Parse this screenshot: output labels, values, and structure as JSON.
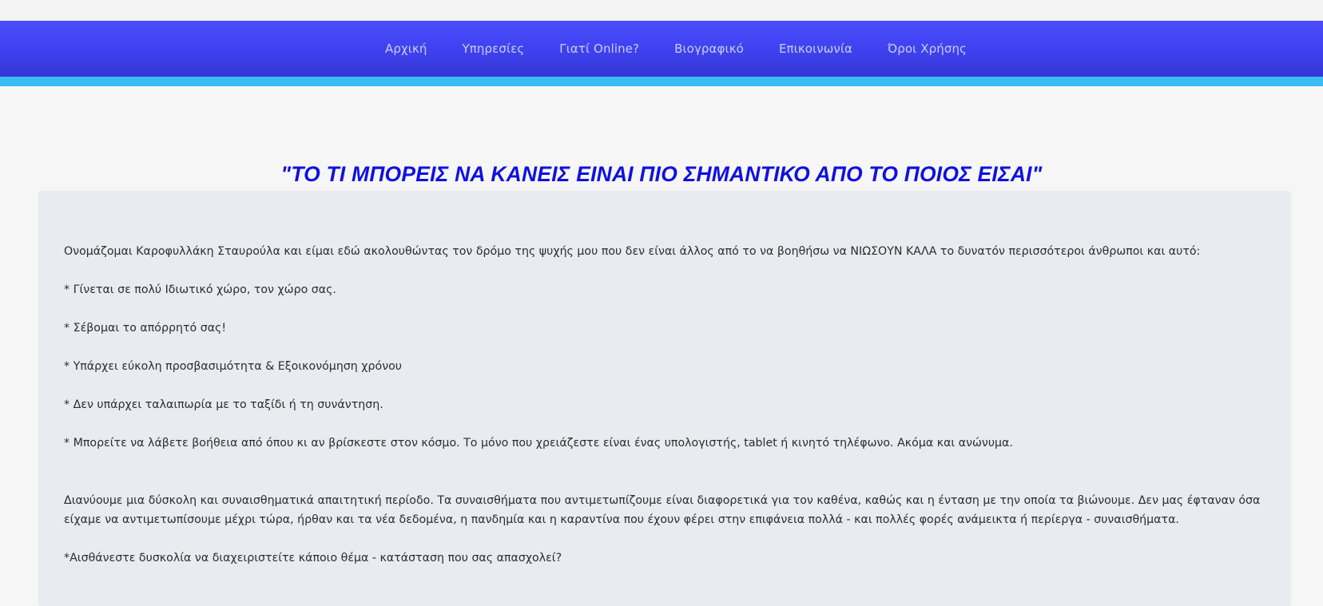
{
  "nav": {
    "items": [
      {
        "label": "Αρχική"
      },
      {
        "label": "Υπηρεσίες"
      },
      {
        "label": "Γιατί Online?"
      },
      {
        "label": "Βιογραφικό"
      },
      {
        "label": "Επικοινωνία"
      },
      {
        "label": "Όροι Χρήσης"
      }
    ]
  },
  "colors": {
    "nav_bg": "#4143f0",
    "nav_accent": "#3bbcf6",
    "headline": "#1010e0",
    "content_bg": "#e8ebef"
  },
  "main": {
    "headline": "\"ΤΟ ΤΙ ΜΠΟΡΕΙΣ ΝΑ ΚΑΝΕΙΣ ΕΙΝΑΙ ΠΙΟ ΣΗΜΑΝΤΙΚΟ ΑΠΟ ΤΟ ΠΟΙΟΣ ΕΙΣΑΙ\"",
    "intro": "Ονομάζομαι Καροφυλλάκη Σταυρούλα και είμαι εδώ ακολουθώντας τον δρόμο της ψυχής μου που δεν είναι άλλος από το να βοηθήσω να ΝΙΩΣΟΥΝ ΚΑΛΑ το δυνατόν περισσότεροι άνθρωποι και αυτό:",
    "bullets": [
      "* Γίνεται σε πολύ Ιδιωτικό χώρο, τον χώρο σας.",
      "* Σέβομαι το απόρρητό σας!",
      "* Υπάρχει εύκολη προσβασιμότητα & Εξοικονόμηση χρόνου",
      "* Δεν υπάρχει ταλαιπωρία με το ταξίδι ή τη συνάντηση.",
      "* Μπορείτε να λάβετε βοήθεια από όπου κι αν βρίσκεστε στον κόσμο. Το μόνο που χρειάζεστε είναι ένας υπολογιστής, tablet ή κινητό τηλέφωνο. Ακόμα και ανώνυμα."
    ],
    "paragraph": "Διανύουμε μια δύσκολη και συναισθηματικά απαιτητική περίοδο. Τα συναισθήματα που αντιμετωπίζουμε είναι διαφορετικά για τον καθένα, καθώς και η ένταση με την οποία τα βιώνουμε. Δεν μας έφταναν όσα είχαμε να αντιμετωπίσουμε μέχρι τώρα, ήρθαν και τα νέα δεδομένα, η πανδημία και η καραντίνα που έχουν φέρει στην επιφάνεια πολλά - και πολλές φορές ανάμεικτα ή περίεργα - συναισθήματα.",
    "question": "*Αισθάνεστε δυσκολία να διαχειριστείτε κάποιο θέμα - κατάσταση που σας απασχολεί?"
  }
}
